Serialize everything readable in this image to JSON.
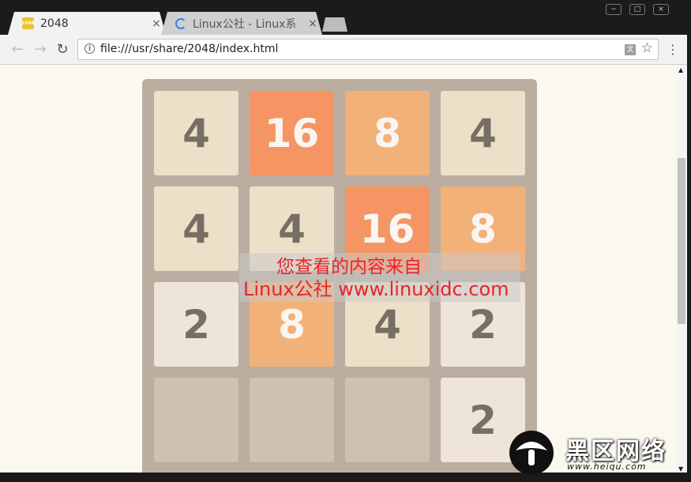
{
  "tabs": [
    {
      "title": "2048",
      "favicon": "2048",
      "close": "×",
      "active": true
    },
    {
      "title": "Linux公社 - Linux系",
      "close": "×",
      "active": false
    }
  ],
  "toolbar": {
    "back_icon": "←",
    "forward_icon": "→",
    "reload_icon": "↻",
    "url": "file:///usr/share/2048/index.html",
    "translate_icon": "文",
    "star_icon": "☆",
    "menu_icon": "⋮"
  },
  "window_controls": [
    "−",
    "□",
    "×"
  ],
  "board": {
    "rows": [
      [
        4,
        16,
        8,
        4
      ],
      [
        4,
        4,
        16,
        8
      ],
      [
        2,
        8,
        4,
        2
      ],
      [
        null,
        null,
        null,
        2
      ]
    ]
  },
  "tile_colors": {
    "empty": "#cdc1b4",
    "2": {
      "bg": "#eee4da",
      "fg": "#776e65"
    },
    "4": {
      "bg": "#ede0c8",
      "fg": "#776e65"
    },
    "8": {
      "bg": "#f2b179",
      "fg": "#f9f6f2"
    },
    "16": {
      "bg": "#f59563",
      "fg": "#f9f6f2"
    }
  },
  "watermark": {
    "line1": "您查看的内容来自",
    "line2": "Linux公社 www.linuxidc.com"
  },
  "corner_logo": {
    "brand": "黑区网络",
    "sub": "www.heiqu.com"
  }
}
